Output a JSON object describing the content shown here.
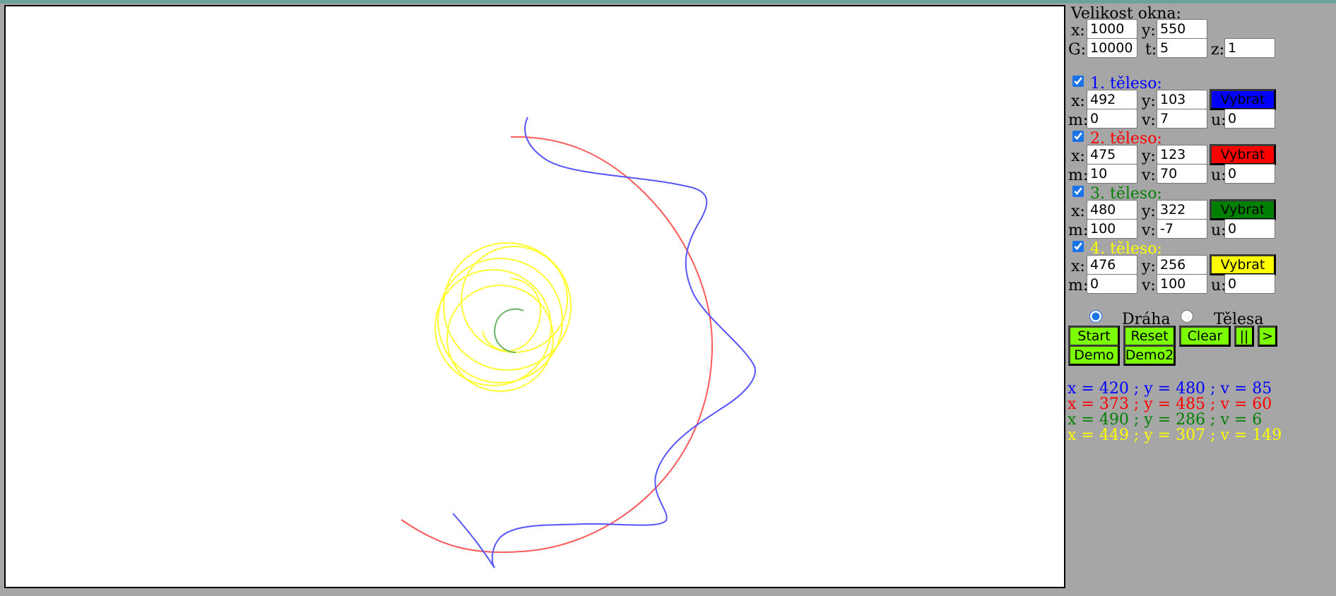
{
  "colors": {
    "body1": "#0000ff",
    "body2": "#ff0000",
    "body3": "#008000",
    "body4": "#ffff00",
    "button_green": "#7bff00",
    "panel_bg": "#a6a6a6"
  },
  "window": {
    "title": "Velikost okna:",
    "x_label": "x:",
    "x_value": "1000",
    "y_label": "y:",
    "y_value": "550",
    "g_label": "G:",
    "g_value": "10000",
    "t_label": "t:",
    "t_value": "5",
    "z_label": "z:",
    "z_value": "1"
  },
  "bodies": [
    {
      "title": "1. těleso:",
      "checked": true,
      "x": "492",
      "y": "103",
      "m": "0",
      "v": "7",
      "u": "0",
      "button": "Vybrat"
    },
    {
      "title": "2. těleso:",
      "checked": true,
      "x": "475",
      "y": "123",
      "m": "10",
      "v": "70",
      "u": "0",
      "button": "Vybrat"
    },
    {
      "title": "3. těleso:",
      "checked": true,
      "x": "480",
      "y": "322",
      "m": "100",
      "v": "-7",
      "u": "0",
      "button": "Vybrat"
    },
    {
      "title": "4. těleso:",
      "checked": true,
      "x": "476",
      "y": "256",
      "m": "0",
      "v": "100",
      "u": "0",
      "button": "Vybrat"
    }
  ],
  "labels": {
    "x": "x:",
    "y": "y:",
    "m": "m:",
    "v": "v:",
    "u": "u:"
  },
  "mode": {
    "option1": "Dráha",
    "option2": "Tělesa",
    "selected": "Dráha"
  },
  "buttons": {
    "start": "Start",
    "reset": "Reset",
    "clear": "Clear",
    "pause": "||",
    "step": ">",
    "demo": "Demo",
    "demo2": "Demo2"
  },
  "readouts": [
    "x = 420 ; y = 480 ; v = 85",
    "x = 373 ; y = 485 ; v = 60",
    "x = 490 ; y = 286 ; v = 6",
    "x = 449 ; y = 307 ; v = 149"
  ]
}
